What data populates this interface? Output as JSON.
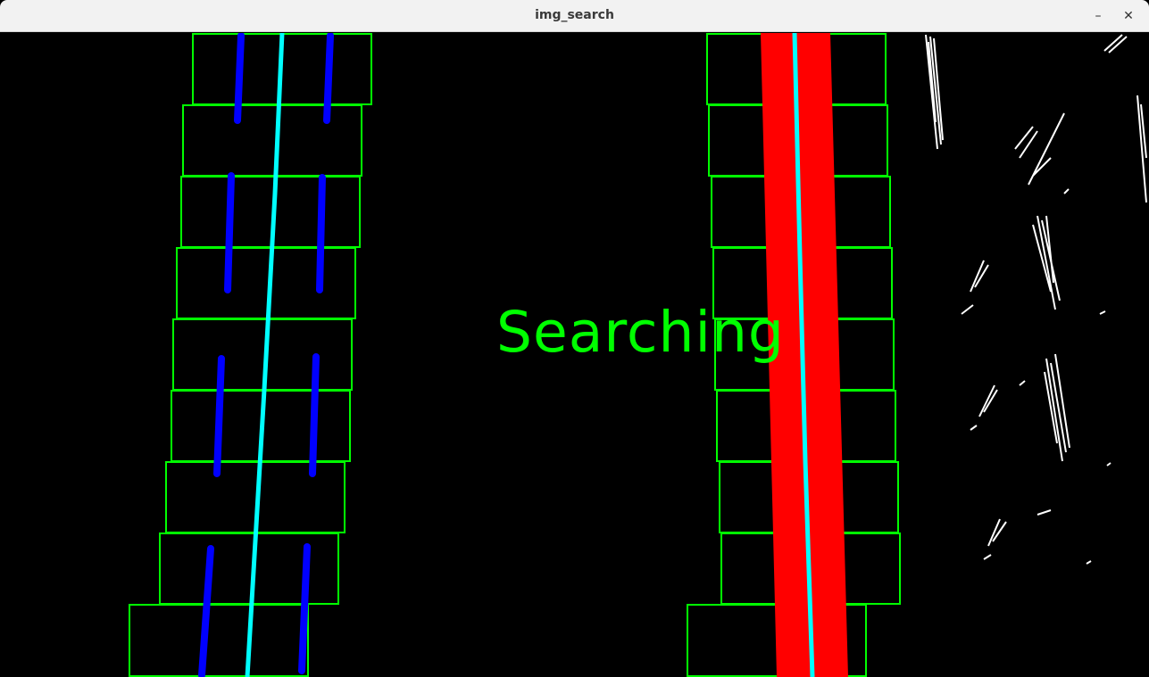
{
  "window": {
    "title": "img_search",
    "minimize_icon": "minimize-icon",
    "close_icon": "close-icon",
    "minimize_glyph": "–",
    "close_glyph": "✕"
  },
  "overlay": {
    "status_text": "Searching",
    "status_color": "#00ff00"
  },
  "colors": {
    "background": "#000000",
    "window_box": "#00ff00",
    "left_lane_pixels": "#0000ff",
    "right_lane_pixels": "#ff0000",
    "fit_line": "#00ffff",
    "noise_pixels": "#ffffff"
  }
}
